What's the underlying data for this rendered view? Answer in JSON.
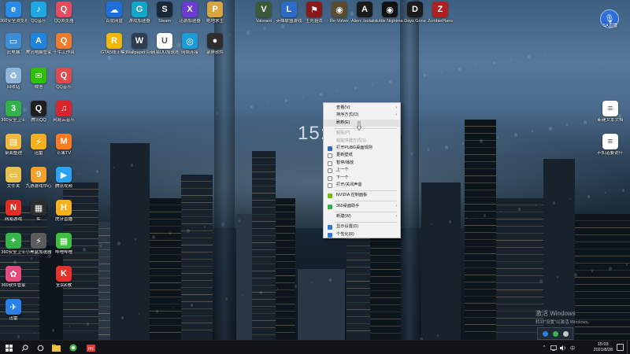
{
  "wallpaper": {
    "clock": "15:0"
  },
  "desktop_icons": [
    {
      "id": "i0",
      "label": "360安全浏览器",
      "icon": "browser-icon",
      "color": "#2a8ae6",
      "ch": "e"
    },
    {
      "id": "i1",
      "label": "QQ音乐",
      "icon": "music-icon",
      "color": "#1ea7e2",
      "ch": "♪"
    },
    {
      "id": "i2",
      "label": "QQ浏览器",
      "icon": "qq-browser-icon",
      "color": "#e84a5f",
      "ch": "Q"
    },
    {
      "id": "i3",
      "label": "百度网盘",
      "icon": "cloud-disk-icon",
      "color": "#1e6fd9",
      "ch": "☁"
    },
    {
      "id": "i4",
      "label": "游戏加速器",
      "icon": "game-accelerator-icon",
      "color": "#11a7c9",
      "ch": "G"
    },
    {
      "id": "i5",
      "label": "Steam",
      "icon": "steam-icon",
      "color": "#1b2838",
      "ch": "S"
    },
    {
      "id": "i6",
      "label": "迅游加速器",
      "icon": "booster-icon",
      "color": "#6c3bd1",
      "ch": "X"
    },
    {
      "id": "i7",
      "label": "绝地求生",
      "icon": "pubg-icon",
      "color": "#d7a640",
      "ch": "P"
    },
    {
      "id": "i8",
      "label": "此电脑",
      "icon": "computer-icon",
      "color": "#3c8fd4",
      "ch": "▭"
    },
    {
      "id": "i9",
      "label": "腾讯电脑管家",
      "icon": "tencent-manager-icon",
      "color": "#1d84e0",
      "ch": "A"
    },
    {
      "id": "i10",
      "label": "千牛工作台",
      "icon": "qianniu-icon",
      "color": "#f07a2a",
      "ch": "Q"
    },
    {
      "id": "i11",
      "label": "GTA5线上模式",
      "icon": "rockstar-icon",
      "color": "#f2b705",
      "ch": "R"
    },
    {
      "id": "i12",
      "label": "Wallpaper Engine",
      "icon": "wallpaper-engine-icon",
      "color": "#2f3d52",
      "ch": "W"
    },
    {
      "id": "i13",
      "label": "网易UU加速器",
      "icon": "uu-booster-icon",
      "color": "#ffffff",
      "ch": "U"
    },
    {
      "id": "i14",
      "label": "网络连接",
      "icon": "network-icon",
      "color": "#1a9cd6",
      "ch": "◎"
    },
    {
      "id": "i15",
      "label": "录屏软件",
      "icon": "recorder-icon",
      "color": "#2d2d2d",
      "ch": "●"
    },
    {
      "id": "i16",
      "label": "回收站",
      "icon": "recycle-bin-icon",
      "color": "#8fb6d8",
      "ch": "♻"
    },
    {
      "id": "i17",
      "label": "微信",
      "icon": "wechat-icon",
      "color": "#2dc100",
      "ch": "✉"
    },
    {
      "id": "i18",
      "label": "QQ音乐",
      "icon": "qq-music-icon",
      "color": "#e14a4a",
      "ch": "Q"
    },
    {
      "id": "i19",
      "label": "360安全卫士",
      "icon": "360-guard-icon",
      "color": "#33b24a",
      "ch": "3"
    },
    {
      "id": "i20",
      "label": "腾讯QQ",
      "icon": "qq-icon",
      "color": "#1f1f1f",
      "ch": "Q"
    },
    {
      "id": "i21",
      "label": "网易云音乐",
      "icon": "netease-music-icon",
      "color": "#d6262d",
      "ch": "♫"
    },
    {
      "id": "i22",
      "label": "桌面整理",
      "icon": "folder-icon",
      "color": "#f0b840",
      "ch": "▤"
    },
    {
      "id": "i23",
      "label": "迅雷",
      "icon": "thunder-icon",
      "color": "#f2b01e",
      "ch": "⚡"
    },
    {
      "id": "i24",
      "label": "芒果TV",
      "icon": "mango-tv-icon",
      "color": "#ff7a1f",
      "ch": "M"
    },
    {
      "id": "i25",
      "label": "文件夹",
      "icon": "file-folder-icon",
      "color": "#e8c04c",
      "ch": "▭"
    },
    {
      "id": "i26",
      "label": "九游游戏中心",
      "icon": "game-center-icon",
      "color": "#f4a12c",
      "ch": "9"
    },
    {
      "id": "i27",
      "label": "腾讯视频",
      "icon": "tencent-video-icon",
      "color": "#2aa3f3",
      "ch": "▶"
    },
    {
      "id": "i28",
      "label": "网易游戏",
      "icon": "netease-game-icon",
      "color": "#e02e24",
      "ch": "N"
    },
    {
      "id": "i29",
      "label": "IE",
      "icon": "app-icon",
      "color": "#2d2d2d",
      "ch": "▦"
    },
    {
      "id": "i30",
      "label": "虎牙直播",
      "icon": "live-icon",
      "color": "#f7b21b",
      "ch": "H"
    },
    {
      "id": "i31",
      "label": "360安全卫士",
      "icon": "360-plus-icon",
      "color": "#35b54a",
      "ch": "+"
    },
    {
      "id": "i32",
      "label": "小黑盒加速器",
      "icon": "xiaoheihe-icon",
      "color": "#5b5b5b",
      "ch": "⚡"
    },
    {
      "id": "i33",
      "label": "哔哩哔哩",
      "icon": "bilibili-icon",
      "color": "#3fbf3f",
      "ch": "▦"
    },
    {
      "id": "i34",
      "label": "360软件管家",
      "icon": "software-manager-icon",
      "color": "#e44b7d",
      "ch": "✿"
    },
    {
      "id": "i35",
      "label": "全民K歌",
      "icon": "karaoke-icon",
      "color": "#e4322b",
      "ch": "K"
    },
    {
      "id": "i36",
      "label": "迅雷",
      "icon": "download-icon",
      "color": "#2a7ee8",
      "ch": "✈"
    },
    {
      "id": "i37",
      "label": "Valorant",
      "icon": "valorant-icon",
      "color": "#3a5a3a",
      "ch": "V"
    },
    {
      "id": "i38",
      "label": "英雄联盟游戏",
      "icon": "lol-icon",
      "color": "#2f6cc7",
      "ch": "L"
    },
    {
      "id": "i39",
      "label": "生死狙击",
      "icon": "shooter-icon",
      "color": "#8a1a1a",
      "ch": "⚑"
    },
    {
      "id": "i40",
      "label": "Re-Volver",
      "icon": "revolver-icon",
      "color": "#5a4a30",
      "ch": "◉"
    },
    {
      "id": "i41",
      "label": "Alien: Isolation",
      "icon": "alien-icon",
      "color": "#1a1a1a",
      "ch": "A"
    },
    {
      "id": "i42",
      "label": "Little Nightmares",
      "icon": "eye-icon",
      "color": "#111111",
      "ch": "◉"
    },
    {
      "id": "i43",
      "label": "Days Gone",
      "icon": "days-gone-icon",
      "color": "#1b1b1b",
      "ch": "D"
    },
    {
      "id": "i44",
      "label": "ZombiePlans",
      "icon": "zombie-icon",
      "color": "#b02020",
      "ch": "Z"
    },
    {
      "id": "i45",
      "label": "新建文本文档",
      "icon": "text-doc-icon",
      "color": "#ffffff",
      "ch": "≡"
    },
    {
      "id": "i46",
      "label": "不知道要说什么",
      "icon": "text-doc-icon-2",
      "color": "#ffffff",
      "ch": "≡"
    }
  ],
  "context_menu": {
    "items": [
      {
        "label": "查看(V)",
        "arrow": true,
        "disabled": false,
        "icon": ""
      },
      {
        "label": "排序方式(O)",
        "arrow": true,
        "disabled": false,
        "icon": ""
      },
      {
        "label": "刷新(E)",
        "arrow": false,
        "disabled": false,
        "icon": "",
        "hover": true
      },
      {
        "sep": true
      },
      {
        "label": "粘贴(P)",
        "arrow": false,
        "disabled": true,
        "icon": ""
      },
      {
        "label": "粘贴快捷方式(S)",
        "arrow": false,
        "disabled": true,
        "icon": ""
      },
      {
        "label": "打开PUBG桌面规则",
        "arrow": false,
        "disabled": false,
        "icon": "#2a6db5"
      },
      {
        "label": "更新壁纸",
        "arrow": false,
        "disabled": false,
        "icon": "#ffffff"
      },
      {
        "label": "暂停/播放",
        "arrow": false,
        "disabled": false,
        "icon": "#ffffff"
      },
      {
        "label": "上一个",
        "arrow": false,
        "disabled": false,
        "icon": "#ffffff"
      },
      {
        "label": "下一个",
        "arrow": false,
        "disabled": false,
        "icon": "#ffffff"
      },
      {
        "label": "打开/关闭声音",
        "arrow": false,
        "disabled": false,
        "icon": "#ffffff"
      },
      {
        "sep": true
      },
      {
        "label": "NVIDIA 控制面板",
        "arrow": false,
        "disabled": false,
        "icon": "#76b900"
      },
      {
        "sep": true
      },
      {
        "label": "360桌面助手",
        "arrow": true,
        "disabled": false,
        "icon": "#2db34a"
      },
      {
        "sep": true
      },
      {
        "label": "新建(W)",
        "arrow": true,
        "disabled": false,
        "icon": ""
      },
      {
        "sep": true
      },
      {
        "label": "显示设置(D)",
        "arrow": false,
        "disabled": false,
        "icon": "#2d78d6"
      },
      {
        "label": "个性化(R)",
        "arrow": false,
        "disabled": false,
        "icon": "#2d78d6"
      }
    ]
  },
  "float_button": {
    "label": "5A直播",
    "icon": "microphone-icon"
  },
  "activate_windows": {
    "line1": "激活 Windows",
    "line2": "转到\"设置\"以激活 Windows。"
  },
  "taskbar": {
    "time": "15:03",
    "date": "2021/8/28",
    "icons": [
      "windows-start-icon",
      "search-icon",
      "cortana-icon",
      "file-explorer-icon",
      "360-browser-taskbar-icon",
      "recorder-taskbar-icon"
    ],
    "tray_arrow": "^"
  }
}
